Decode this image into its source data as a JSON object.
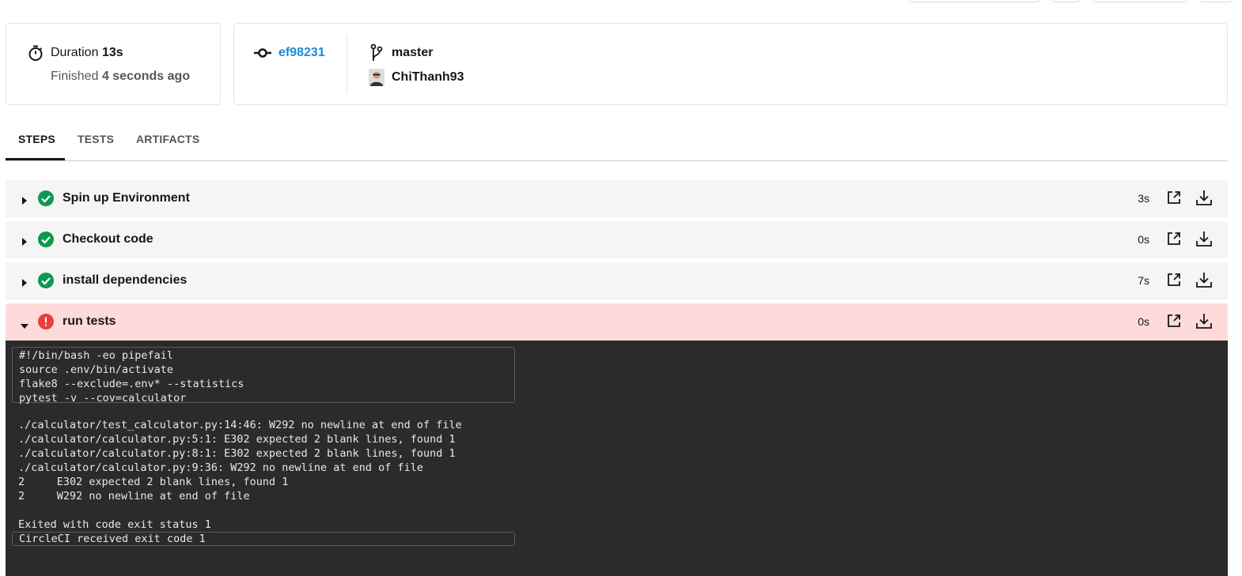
{
  "summary": {
    "duration_label": "Duration",
    "duration_value": "13s",
    "finished_label": "Finished",
    "finished_value": "4 seconds ago",
    "commit_hash": "ef98231",
    "branch": "master",
    "author": "ChiThanh93"
  },
  "tabs": [
    {
      "label": "STEPS"
    },
    {
      "label": "TESTS"
    },
    {
      "label": "ARTIFACTS"
    }
  ],
  "steps": [
    {
      "name": "Spin up Environment",
      "duration": "3s",
      "status": "success"
    },
    {
      "name": "Checkout code",
      "duration": "0s",
      "status": "success"
    },
    {
      "name": "install dependencies",
      "duration": "7s",
      "status": "success"
    },
    {
      "name": "run tests",
      "duration": "0s",
      "status": "failed"
    }
  ],
  "console": {
    "command_lines": "#!/bin/bash -eo pipefail\nsource .env/bin/activate\nflake8 --exclude=.env* --statistics\npytest -v --cov=calculator",
    "output_lines": "./calculator/test_calculator.py:14:46: W292 no newline at end of file\n./calculator/calculator.py:5:1: E302 expected 2 blank lines, found 1\n./calculator/calculator.py:8:1: E302 expected 2 blank lines, found 1\n./calculator/calculator.py:9:36: W292 no newline at end of file\n2     E302 expected 2 blank lines, found 1\n2     W292 no newline at end of file\n\nExited with code exit status 1",
    "final_line": "CircleCI received exit code 1"
  },
  "colors": {
    "success": "#0c9a52",
    "failed": "#e54040",
    "link": "#1f8ad6"
  }
}
